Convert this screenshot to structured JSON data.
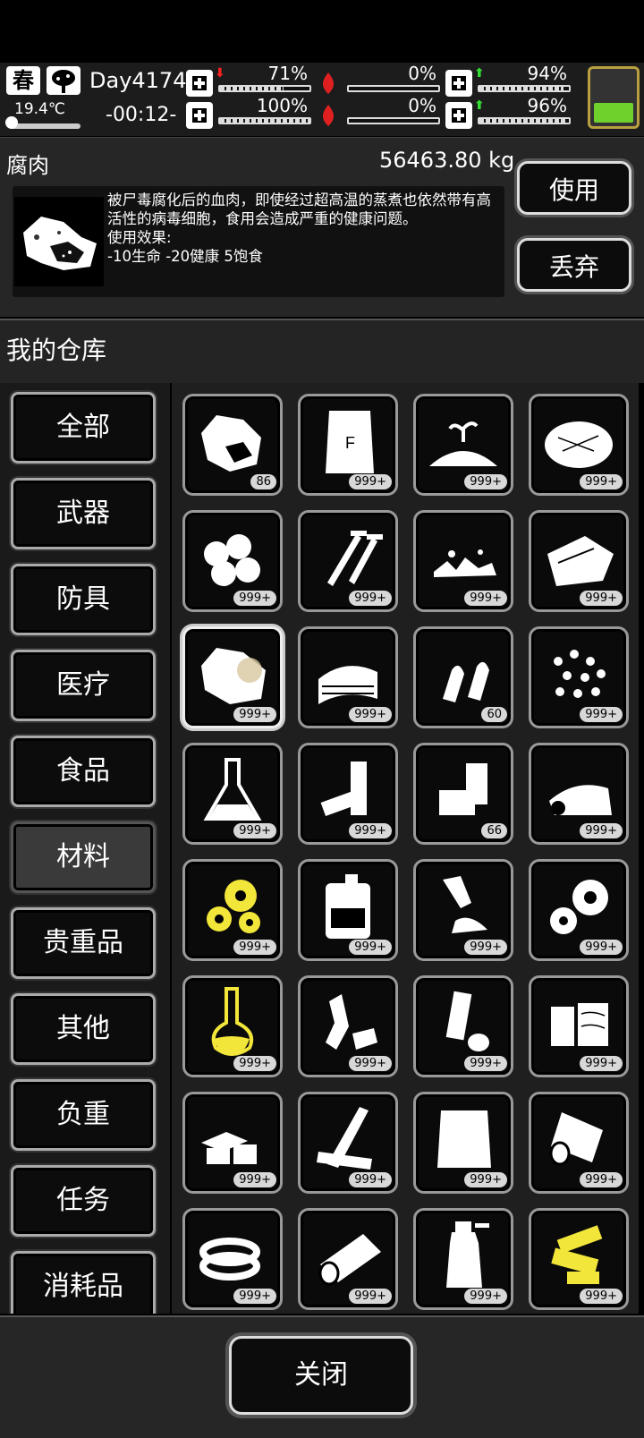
{
  "status": {
    "season": "春",
    "weather_icon": "cloud-tree-icon",
    "temperature": "19.4℃",
    "day": "Day4174",
    "time": "-00:12-",
    "stats": [
      {
        "key": "health",
        "icon": "medkit-icon",
        "icon_color": "#ffffff",
        "arrow": "down",
        "arrow_color": "#ff2222",
        "pct": "71%",
        "fill": 0.71
      },
      {
        "key": "hunger",
        "icon": "stomach-icon",
        "icon_color": "#e02020",
        "arrow": "",
        "pct": "0%",
        "fill": 0.0
      },
      {
        "key": "stamina",
        "icon": "pill-icon",
        "icon_color": "#ffffff",
        "arrow": "up",
        "arrow_color": "#33dd33",
        "pct": "94%",
        "fill": 0.94
      },
      {
        "key": "leg",
        "icon": "boot-icon",
        "icon_color": "#ffffff",
        "arrow": "",
        "pct": "100%",
        "fill": 1.0
      },
      {
        "key": "thirst",
        "icon": "blood-drop-icon",
        "icon_color": "#e02020",
        "arrow": "",
        "pct": "0%",
        "fill": 0.0
      },
      {
        "key": "mood",
        "icon": "heart-icon",
        "icon_color": "#ffffff",
        "arrow": "up",
        "arrow_color": "#33dd33",
        "pct": "96%",
        "fill": 0.96
      }
    ],
    "battery_color": "#6fd12c"
  },
  "detail": {
    "name": "腐肉",
    "weight": "56463.80 kg",
    "description": "被尸毒腐化后的血肉，即使经过超高温的蒸煮也依然带有高活性的病毒细胞，食用会造成严重的健康问题。\n使用效果:\n-10生命 -20健康 5饱食",
    "use_label": "使用",
    "discard_label": "丢弃"
  },
  "warehouse_title": "我的仓库",
  "categories": [
    "全部",
    "武器",
    "防具",
    "医疗",
    "食品",
    "材料",
    "贵重品",
    "其他",
    "负重",
    "任务",
    "消耗品"
  ],
  "active_category": "材料",
  "items": [
    {
      "icon": "rotten-meat-icon",
      "count": "86",
      "color": "#ffffff"
    },
    {
      "icon": "fertilizer-bag-icon",
      "count": "999+",
      "color": "#ffffff"
    },
    {
      "icon": "soil-sprout-icon",
      "count": "999+",
      "color": "#ffffff"
    },
    {
      "icon": "hay-pile-icon",
      "count": "999+",
      "color": "#ffffff"
    },
    {
      "icon": "cotton-balls-icon",
      "count": "999+",
      "color": "#ffffff"
    },
    {
      "icon": "screws-icon",
      "count": "999+",
      "color": "#ffffff"
    },
    {
      "icon": "gravel-icon",
      "count": "999+",
      "color": "#ffffff"
    },
    {
      "icon": "cloth-icon",
      "count": "999+",
      "color": "#ffffff"
    },
    {
      "icon": "raw-meat-icon",
      "count": "999+",
      "color": "#ffffff"
    },
    {
      "icon": "folded-towels-icon",
      "count": "999+",
      "color": "#ffffff"
    },
    {
      "icon": "bullets-icon",
      "count": "60",
      "color": "#ffffff"
    },
    {
      "icon": "pellets-icon",
      "count": "999+",
      "color": "#ffffff"
    },
    {
      "icon": "flask-icon",
      "count": "999+",
      "color": "#ffffff"
    },
    {
      "icon": "batteries-icon",
      "count": "999+",
      "color": "#ffffff"
    },
    {
      "icon": "tin-cans-icon",
      "count": "66",
      "color": "#ffffff"
    },
    {
      "icon": "fabric-roll-icon",
      "count": "999+",
      "color": "#ffffff"
    },
    {
      "icon": "gold-gears-icon",
      "count": "999+",
      "color": "#f2e63a"
    },
    {
      "icon": "jerrycan-icon",
      "count": "999+",
      "color": "#ffffff"
    },
    {
      "icon": "glue-tube-icon",
      "count": "999+",
      "color": "#ffffff"
    },
    {
      "icon": "gears-icon",
      "count": "999+",
      "color": "#ffffff"
    },
    {
      "icon": "yellow-flask-icon",
      "count": "999+",
      "color": "#f2e63a"
    },
    {
      "icon": "plastic-bottles-icon",
      "count": "999+",
      "color": "#ffffff"
    },
    {
      "icon": "pipe-cup-icon",
      "count": "999+",
      "color": "#ffffff"
    },
    {
      "icon": "wood-blocks-icon",
      "count": "999+",
      "color": "#ffffff"
    },
    {
      "icon": "bricks-icon",
      "count": "999+",
      "color": "#ffffff"
    },
    {
      "icon": "planks-icon",
      "count": "999+",
      "color": "#ffffff"
    },
    {
      "icon": "paper-sheet-icon",
      "count": "999+",
      "color": "#ffffff"
    },
    {
      "icon": "paper-roll-icon",
      "count": "999+",
      "color": "#ffffff"
    },
    {
      "icon": "tape-roll-icon",
      "count": "999+",
      "color": "#ffffff"
    },
    {
      "icon": "leather-roll-icon",
      "count": "999+",
      "color": "#ffffff"
    },
    {
      "icon": "spray-bottle-icon",
      "count": "999+",
      "color": "#ffffff"
    },
    {
      "icon": "circuit-parts-icon",
      "count": "999+",
      "color": "#f2e63a"
    }
  ],
  "selected_item_index": 8,
  "close_label": "关闭"
}
